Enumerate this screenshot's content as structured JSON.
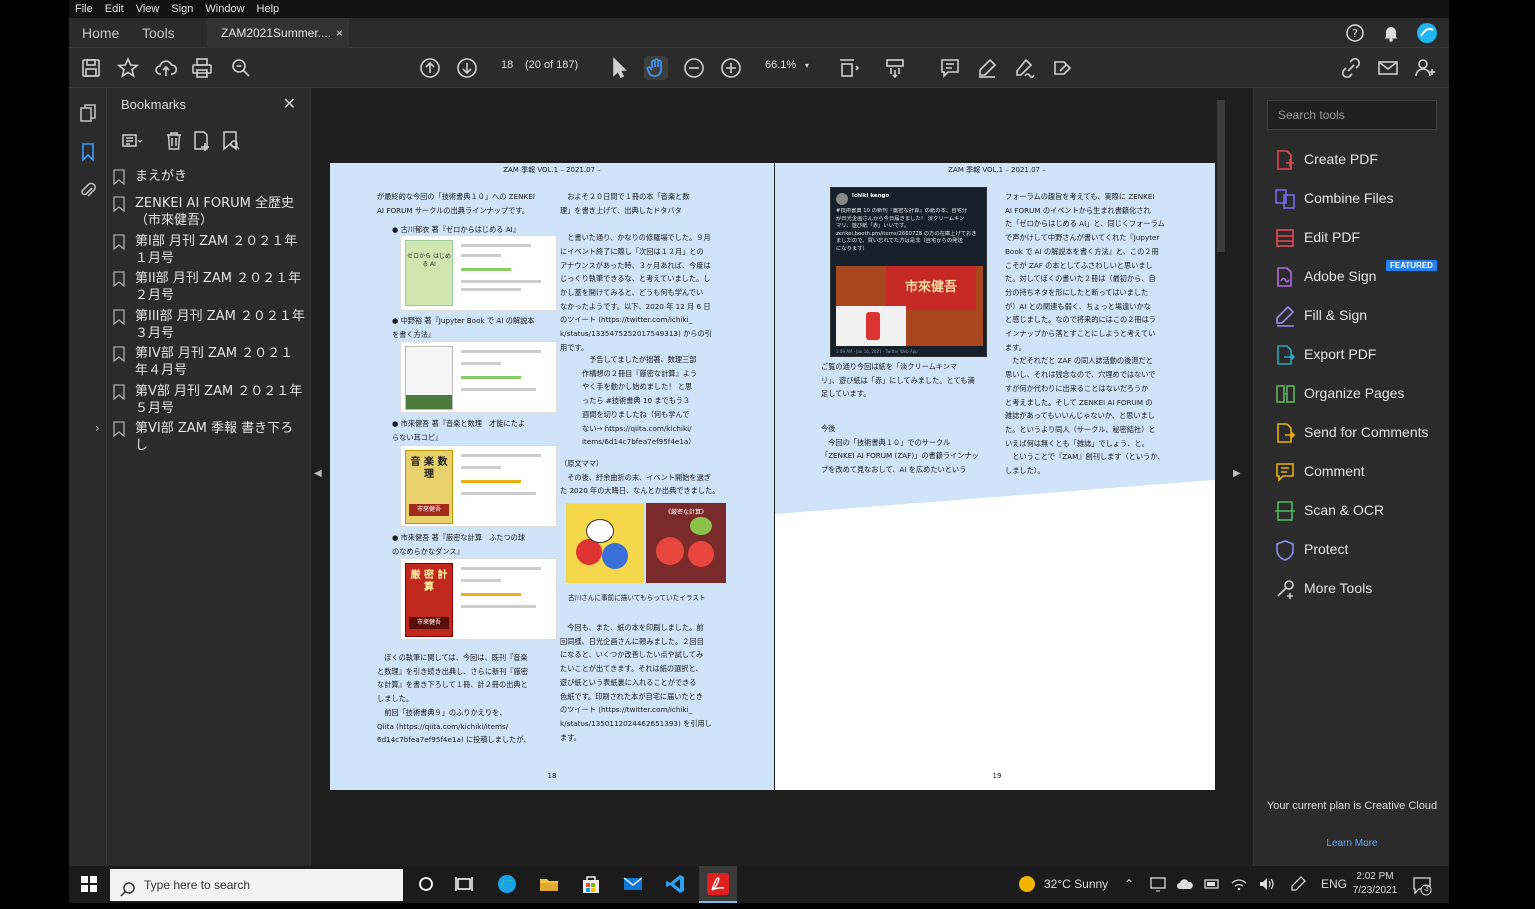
{
  "menu": [
    "File",
    "Edit",
    "View",
    "Sign",
    "Window",
    "Help"
  ],
  "tabs": {
    "home": "Home",
    "tools": "Tools",
    "document": "ZAM2021Summer....",
    "close": "×"
  },
  "toolbar": {
    "current_page": "18",
    "page_info": "(20 of 187)",
    "zoom": "66.1%"
  },
  "bookmarks": {
    "title": "Bookmarks",
    "close": "✕",
    "items": [
      "まえがき",
      "ZENKEI AI FORUM 全歴史（市來健吾）",
      "第I部 月刊 ZAM ２０２１年１月号",
      "第II部 月刊 ZAM ２０２１年２月号",
      "第III部 月刊 ZAM ２０２１年３月号",
      "第IV部 月刊 ZAM ２０２１年４月号",
      "第V部 月刊 ZAM ２０２１年５月号",
      "第VI部 ZAM 季報 書き下ろし"
    ]
  },
  "pages": {
    "left": {
      "header": "ZAM 季報 VOL.1 – 2021.07 –",
      "number": "18",
      "col1_intro": "が最終的な今回の「技術書典１０」への ZENKEI\nAI FORUM サークルの出典ラインナップです。",
      "bullet1": "古川郁衣 著『ゼロからはじめる AI』",
      "bullet2": "中野裕 著『Jupyter Book で AI の解説本\nを書く方法』",
      "bullet3": "市來健吾 著『音楽と数理　才能にたよ\nらない耳コピ』",
      "bullet4": "市來健吾 著『厳密な計算　ふたつの球\nのなめらかなダンス』",
      "col1_body": "　ぼくの執筆に関しては、今回は、既刊『音楽\nと数理』を引き続き出典し、さらに新刊『厳密\nな計算』を書き下ろして１冊、計２冊の出典と\nしました。\n　前回「技術書典９」のふりかえりを、\nQiita (https://qiita.com/kichiki/items/\n6d14c7bfea7ef95f4e1a) に投稿しましたが、",
      "col2_a": "　およそ２０日間で１冊の本「音楽と数\n理」を書き上げて、出典したドタバタ\n\n　と書いた通り、かなりの修羅場でした。９月\nにイベント終了に際し「次回は１２月」との\nアナウンスがあった時、３ヶ月あれば、今度は\nじっくり執筆できるな、と考えていました。し\nかし蓋を開けてみると、どうも何も学んでい\nなかったようです。以下、2020 年 12 月 6 日\nのツイート (https://twitter.com/ichiki_\nk/status/1335475252017549313) からの引\n用です。",
      "col2_b": "　予告してましたが拙著、数理三部\n作構想の２冊目『厳密な計算』よう\nやく手を動かし始めました！ と思\nったら #技術書典 10 までもう３\n週間を切りましたね（何も学んで\nない→ https://qiita.com/kichiki/\nitems/6d14c7bfea7ef95f4e1a）",
      "col2_c": "（原文ママ）\n　その後、紆余曲折の末、イベント開始を過ぎ\nた 2020 年の大晦日、なんとか出典できました。",
      "caption": "古川さんに事前に描いてもらっていたイラスト",
      "col2_d": "　今回も、また、紙の本を印刷しました。前\n回同様、日光企画さんに頼みました。２回目\nになると、いくつか改善したい点や試してみ\nたいことが出てきます。それは紙の選択と、\n遊び紙という表紙裏に入れることができる\n色紙です。印刷された本が自宅に届いたとき\nのツイート (https://twitter.com/ichiki_\nk/status/1350112024462651393) を引用し\nます。",
      "cover_texts": [
        "ゼロから はじめる AI",
        "音 楽 数 理",
        "市來健吾",
        "厳 密 計 算",
        "市來健吾",
        "《厳密な計算》"
      ]
    },
    "right": {
      "header": "ZAM 季報 VOL.1 – 2021.07 –",
      "number": "19",
      "tweet_author": "ichiki kengo",
      "tweet_text": "#技術書典 10 の新刊『厳密な計算』の紙の本、自宅分\nが日光企画さんから今日届きました！ 淡クリームキン\nマリ、遊び紙「赤」いいです。\nzenkei.booth.pm/items/2660728 の方の在庫上げておき\nましたので、買い忘れてた方は是非（自宅からの発送\nになります）",
      "tweet_footer": "1:09 AM · Jan 16, 2021 · Twitter Web App",
      "tweet_photo_text": "市來健吾",
      "col1_a": "ご覧の通り今回は紙を「淡クリームキンマ\nリ」、遊び紙は「赤」にしてみました。とても満\n足しています。",
      "col1_b": "今後\n　今回の「技術書典１０」でのサークル\n「ZENKEI AI FORUM (ZAF)」の書籍ラインナッ\nプを改めて見なおして、AI を広めたいという",
      "col2": "フォーラムの趣旨を考えても、実際に ZENKEI\nAI FORUM のイベントから生まれ書籍化され\nた「ゼロからはじめる AI」と、同じくフォーラム\nで声かけして中野さんが書いてくれた『Jupyter\nBook で AI の解説本を書く方法』と、この２冊\nこそが ZAF の本としてふさわしいと思いまし\nた。対してぼくの書いた２冊は（最初から、自\n分の持ちネタを形にしたと断ってはいました\nが）AI との関連も弱く、ちょっと場違いかな\nと感じました。なので将来的にはこの２冊はラ\nインナップから落とすことにしようと考えてい\nます。\n　ただそれだと ZAF の同人誌活動の後退だと\n思いし、それは残念なので、穴埋めではないで\nすが何か代わりに出来ることはないだろうか\nと考えました。そして ZENKEI AI FORUM の\n雑誌があってもいいんじゃないか、と思いまし\nた。というより同人（サークル、秘密結社）と\nいえば何は無くとも「雑誌」でしょう、と。\n　ということで『ZAM』創刊します（というか、\nしました）。"
    }
  },
  "tools": {
    "search_placeholder": "Search tools",
    "featured": "FEATURED",
    "items": [
      {
        "label": "Create PDF",
        "icon": "create-pdf-icon",
        "color": "#e34850"
      },
      {
        "label": "Combine Files",
        "icon": "combine-files-icon",
        "color": "#7b68ee"
      },
      {
        "label": "Edit PDF",
        "icon": "edit-pdf-icon",
        "color": "#e34850"
      },
      {
        "label": "Adobe Sign",
        "icon": "adobe-sign-icon",
        "color": "#b26ae2"
      },
      {
        "label": "Fill & Sign",
        "icon": "fill-sign-icon",
        "color": "#9e8cf0"
      },
      {
        "label": "Export PDF",
        "icon": "export-pdf-icon",
        "color": "#2ba6bc"
      },
      {
        "label": "Organize Pages",
        "icon": "organize-pages-icon",
        "color": "#5cb85c"
      },
      {
        "label": "Send for Comments",
        "icon": "send-comments-icon",
        "color": "#e8b10f"
      },
      {
        "label": "Comment",
        "icon": "comment-icon",
        "color": "#e8b10f"
      },
      {
        "label": "Scan & OCR",
        "icon": "scan-ocr-icon",
        "color": "#4cbb5e"
      },
      {
        "label": "Protect",
        "icon": "protect-icon",
        "color": "#8e8ef0"
      },
      {
        "label": "More Tools",
        "icon": "more-tools-icon",
        "color": "#cfcfcf"
      }
    ],
    "plan": "Your current plan is Creative Cloud",
    "learn_more": "Learn More"
  },
  "taskbar": {
    "search_placeholder": "Type here to search",
    "weather": "32°C  Sunny",
    "lang": "ENG",
    "time": "2:02 PM",
    "date": "7/23/2021",
    "notifications": "3"
  }
}
